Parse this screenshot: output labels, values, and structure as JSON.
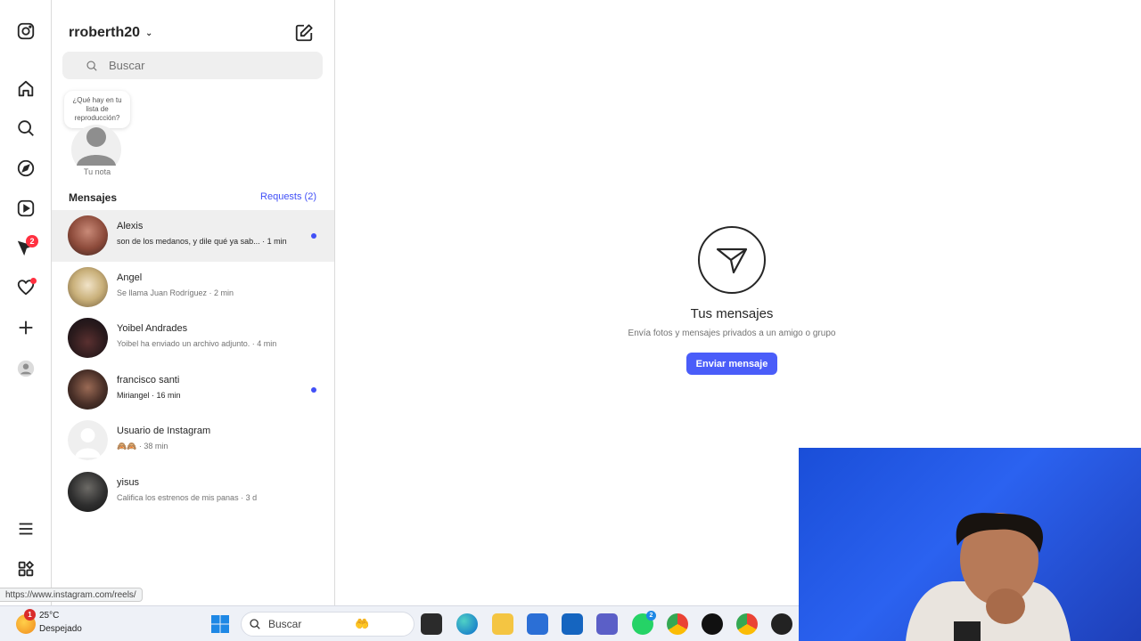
{
  "inbox": {
    "account_name": "rroberth20",
    "search_placeholder": "Buscar",
    "note_bubble": "¿Qué hay en tu lista de reproducción?",
    "note_label": "Tu nota",
    "section_title": "Mensajes",
    "requests_label": "Requests (2)",
    "threads": [
      {
        "name": "Alexis",
        "preview": "son de los medanos, y dile qué ya sab... · 1 min",
        "unread": true,
        "active": true
      },
      {
        "name": "Angel",
        "preview": "Se llama Juan Rodríguez · 2 min",
        "unread": false
      },
      {
        "name": "Yoibel Andrades",
        "preview": "Yoibel ha enviado un archivo adjunto. · 4 min",
        "unread": false
      },
      {
        "name": "francisco santi",
        "preview": "Miriangel · 16 min",
        "unread": true
      },
      {
        "name": "Usuario de Instagram",
        "preview": "🙈🙈 · 38 min",
        "unread": false
      },
      {
        "name": "yisus",
        "preview": "Califica los estrenos de mis panas · 3 d",
        "unread": false
      }
    ]
  },
  "rail": {
    "notifications_badge": "2",
    "icons": [
      "instagram-icon",
      "home-icon",
      "search-icon",
      "explore-icon",
      "reels-icon",
      "messages-icon",
      "heart-icon",
      "create-icon",
      "profile-icon",
      "menu-icon",
      "apps-icon"
    ]
  },
  "main": {
    "empty_title": "Tus mensajes",
    "empty_subtitle": "Envía fotos y mensajes privados a un amigo o grupo",
    "send_button": "Enviar mensaje"
  },
  "status_url": "https://www.instagram.com/reels/",
  "taskbar": {
    "weather_temp": "25°C",
    "weather_desc": "Despejado",
    "weather_badge": "1",
    "search_label": "Buscar",
    "whatsapp_badge": "2"
  },
  "colors": {
    "accent": "#4a5df9",
    "unread_dot": "#4150f7",
    "badge_red": "#ff3040"
  }
}
